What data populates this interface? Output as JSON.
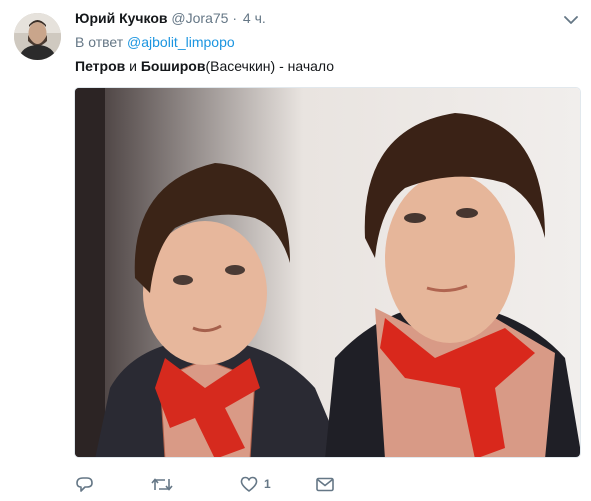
{
  "tweet": {
    "author_name": "Юрий Кучков",
    "author_handle": "@Jora75",
    "separator": "·",
    "time": "4 ч.",
    "reply_prefix": "В ответ",
    "reply_mention": "@ajbolit_limpopo",
    "text_part1": "Петров",
    "text_part2": " и ",
    "text_part3": "Боширов",
    "text_part4": "(Васечкин) - начало"
  },
  "actions": {
    "reply_icon": "reply-icon",
    "retweet_icon": "retweet-icon",
    "like_icon": "heart-icon",
    "like_count": "1",
    "dm_icon": "envelope-icon"
  },
  "colors": {
    "text": "#14171a",
    "secondary": "#657786",
    "link": "#1b95e0"
  }
}
